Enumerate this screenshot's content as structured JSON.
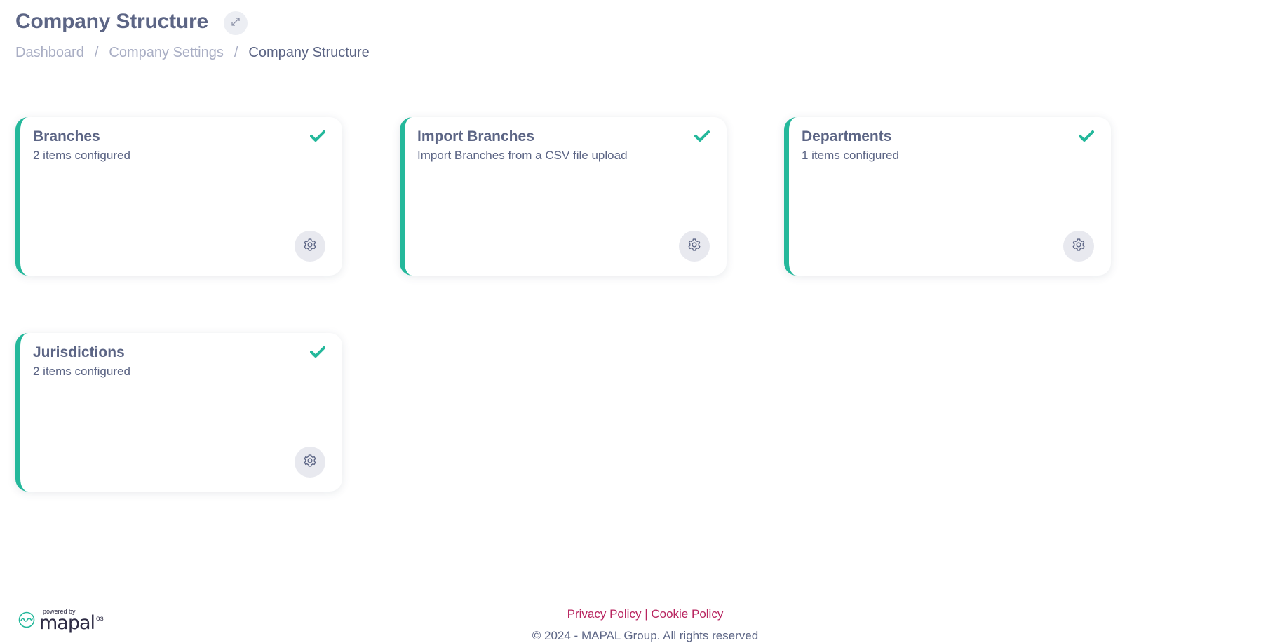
{
  "header": {
    "title": "Company Structure",
    "breadcrumb": [
      "Dashboard",
      "Company Settings",
      "Company Structure"
    ],
    "separator": "/"
  },
  "cards": [
    {
      "title": "Branches",
      "subtitle": "2 items configured",
      "status": "check-icon"
    },
    {
      "title": "Import Branches",
      "subtitle": "Import Branches from a CSV file upload",
      "status": "check-icon"
    },
    {
      "title": "Departments",
      "subtitle": "1 items configured",
      "status": "check-icon"
    },
    {
      "title": "Jurisdictions",
      "subtitle": "2 items configured",
      "status": "check-icon"
    }
  ],
  "footer": {
    "privacy": "Privacy Policy",
    "divider": "|",
    "cookie": "Cookie Policy",
    "copyright": "© 2024 - MAPAL Group. All rights reserved"
  },
  "logo": {
    "powered_by": "powered by",
    "word": "mapal",
    "suffix": "os"
  },
  "colors": {
    "accent": "#24b89b",
    "text": "#5c6585",
    "muted": "#a9aec4",
    "link": "#b8245f"
  }
}
